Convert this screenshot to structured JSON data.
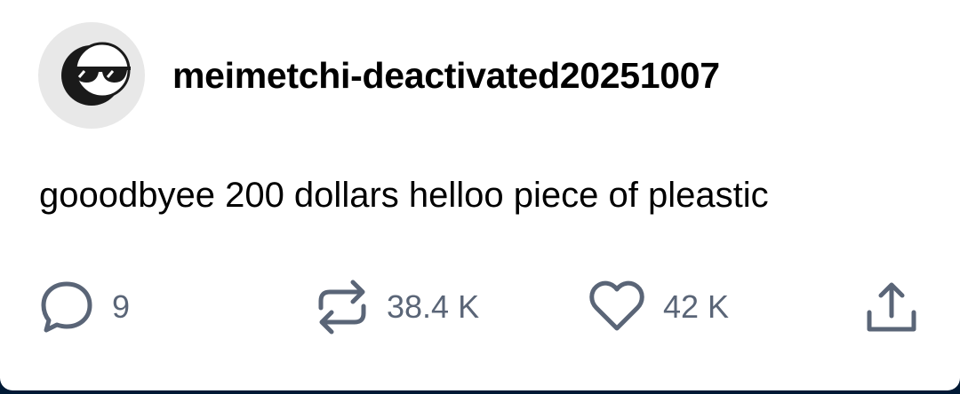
{
  "post": {
    "username": "meimetchi-deactivated20251007",
    "text": "gooodbyee 200 dollars helloo piece of pleastic"
  },
  "actions": {
    "replies": "9",
    "reblogs": "38.4 K",
    "likes": "42 K"
  },
  "icons": {
    "avatar": "moon-with-sunglasses-icon",
    "reply": "speech-bubble-icon",
    "reblog": "reblog-arrows-icon",
    "like": "heart-icon",
    "share": "share-upload-icon"
  },
  "colors": {
    "card_background": "#ffffff",
    "page_background": "#001935",
    "icon_gray": "#5a6577",
    "text": "#000000"
  }
}
